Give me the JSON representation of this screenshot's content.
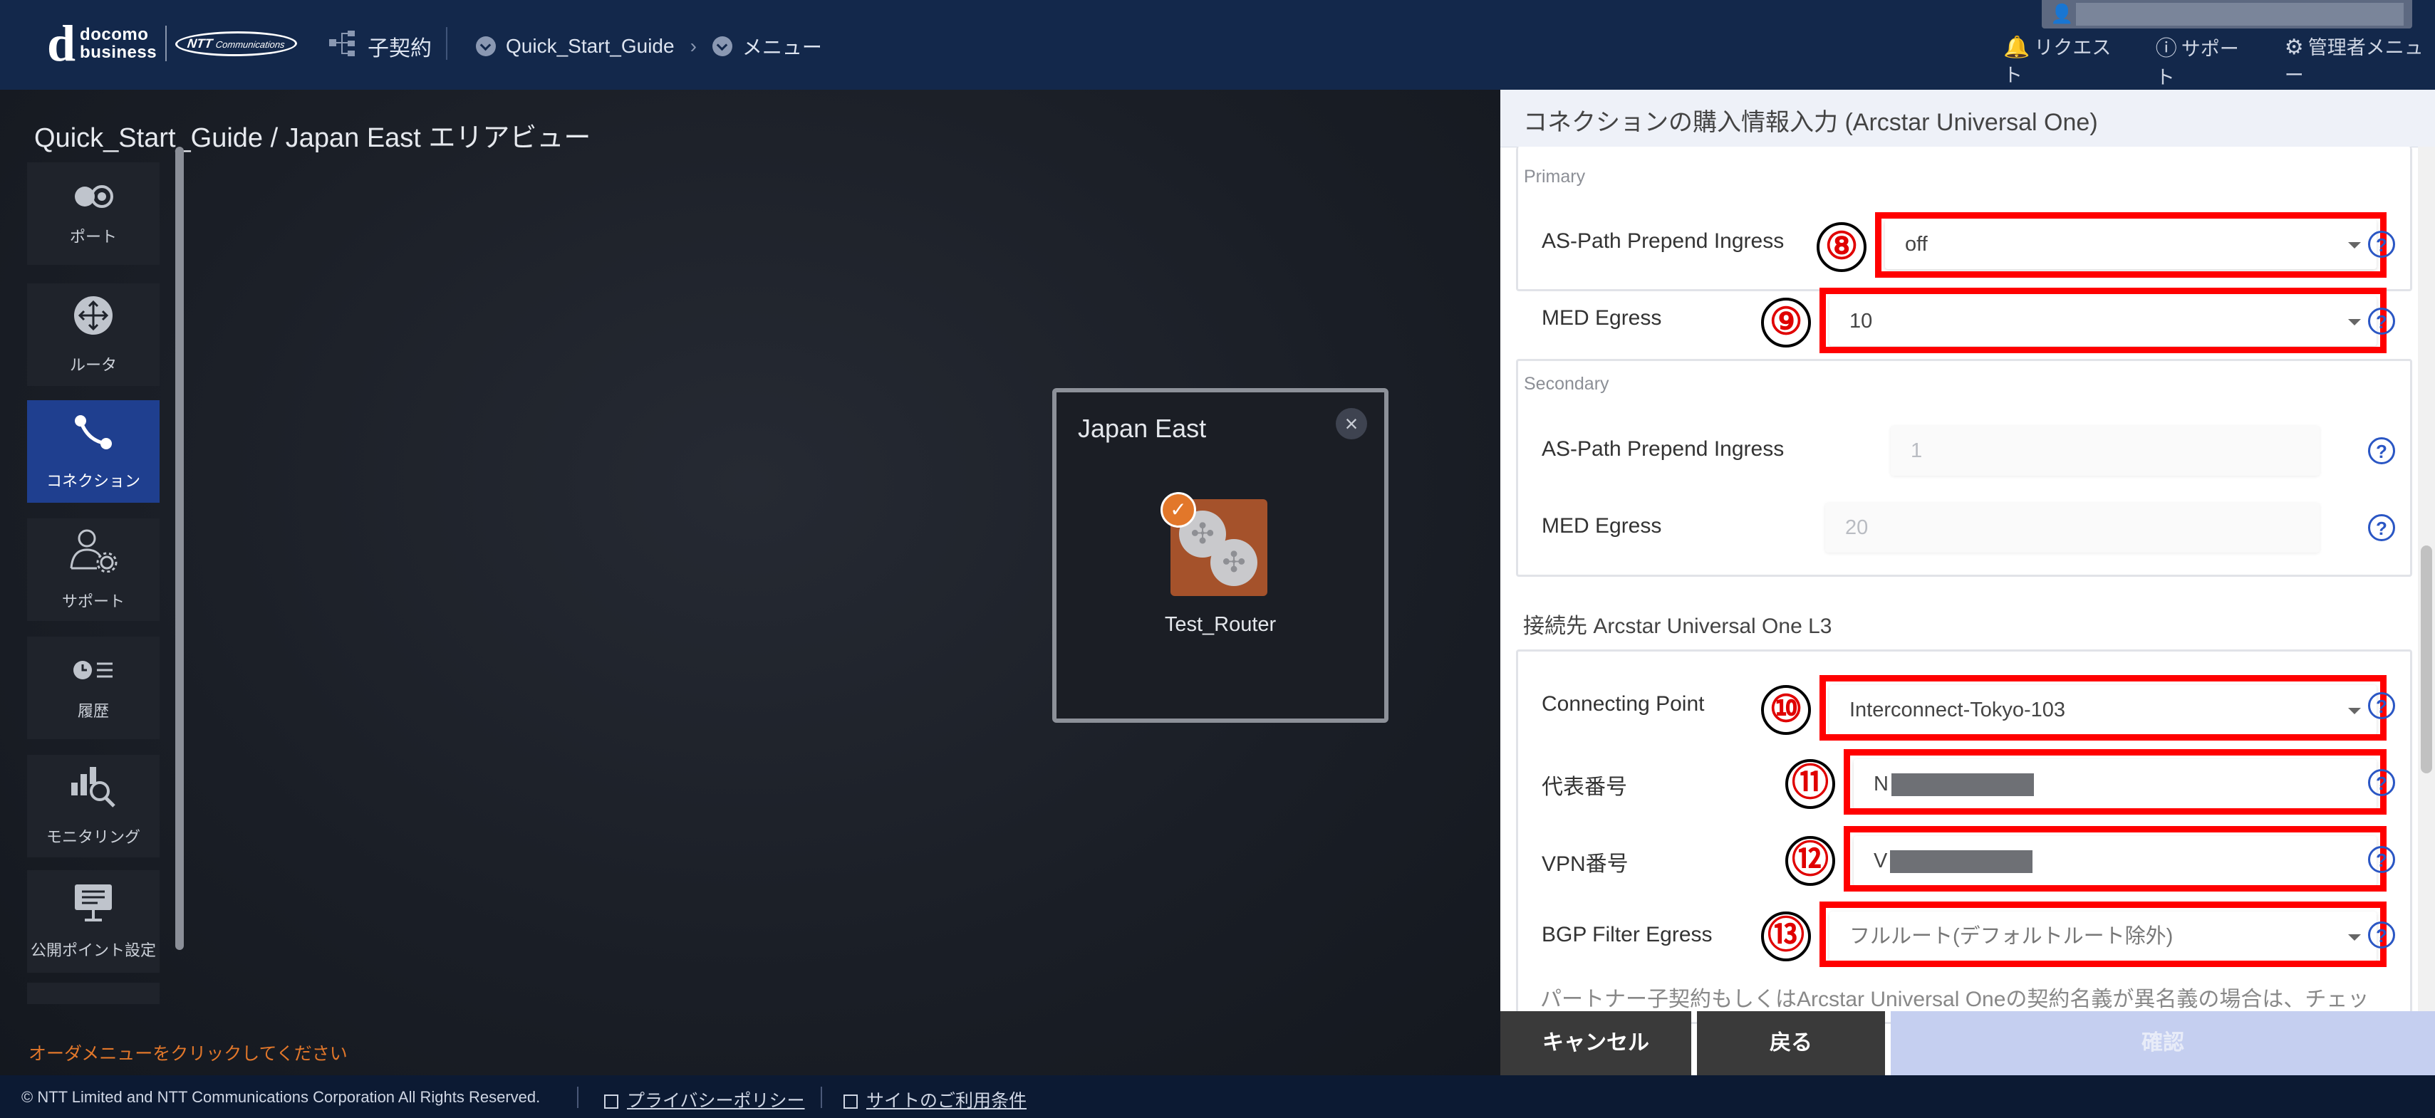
{
  "header": {
    "logo_line1": "docomo",
    "logo_line2": "business",
    "logo_ntt": "NTT",
    "logo_ntt_sub": "Communications",
    "contract_label": "子契約",
    "breadcrumb_guide": "Quick_Start_Guide",
    "breadcrumb_menu": "メニュー",
    "menu_request": "リクエスト",
    "menu_support": "サポート",
    "menu_admin": "管理者メニュー"
  },
  "workspace": {
    "title": "Quick_Start_Guide / Japan East エリアビュー",
    "order_hint": "オーダメニューをクリックしてください",
    "area": {
      "title": "Japan East",
      "router_label": "Test_Router"
    }
  },
  "sidebar": {
    "items": [
      {
        "label": "ポート",
        "icon": "port-icon",
        "glyph": "⬤"
      },
      {
        "label": "ルータ",
        "icon": "router-icon",
        "glyph": "✣"
      },
      {
        "label": "コネクション",
        "icon": "connection-icon",
        "glyph": "⤷"
      },
      {
        "label": "サポート",
        "icon": "support-icon",
        "glyph": "⚙"
      },
      {
        "label": "履歴",
        "icon": "history-icon",
        "glyph": "◔"
      },
      {
        "label": "モニタリング",
        "icon": "monitoring-icon",
        "glyph": "⌕"
      },
      {
        "label": "公開ポイント設定",
        "icon": "public-point-icon",
        "glyph": "▤"
      }
    ]
  },
  "panel": {
    "title": "コネクションの購入情報入力 (Arcstar Universal One)",
    "primary": {
      "group_label": "Primary",
      "as_path_label": "AS-Path Prepend Ingress",
      "as_path_value": "off",
      "med_label": "MED Egress",
      "med_value": "10"
    },
    "secondary": {
      "group_label": "Secondary",
      "as_path_label": "AS-Path Prepend Ingress",
      "as_path_value": "1",
      "med_label": "MED Egress",
      "med_value": "20"
    },
    "l3": {
      "title": "接続先 Arcstar Universal One L3",
      "connecting_point_label": "Connecting Point",
      "connecting_point_value": "Interconnect-Tokyo-103",
      "rep_number_label": "代表番号",
      "rep_number_prefix": "N",
      "vpn_number_label": "VPN番号",
      "vpn_number_prefix": "V",
      "bgp_filter_label": "BGP Filter Egress",
      "bgp_filter_value": "フルルート(デフォルトルート除外)"
    },
    "partner_note": "パートナー子契約もしくはArcstar Universal Oneの契約名義が異名義の場合は、チェッ",
    "help_glyph": "?",
    "callouts": [
      "⑧",
      "⑨",
      "⑩",
      "⑪",
      "⑫",
      "⑬"
    ],
    "buttons": {
      "cancel": "キャンセル",
      "back": "戻る",
      "confirm": "確認"
    }
  },
  "footer": {
    "copyright": "© NTT Limited and NTT Communications Corporation All Rights Reserved.",
    "privacy": "プライバシーポリシー",
    "terms": "サイトのご利用条件"
  },
  "colors": {
    "accent_red": "#ff0000",
    "active_nav": "#1f3f8f",
    "header_bg": "#13284b",
    "orange": "#e2772a"
  }
}
